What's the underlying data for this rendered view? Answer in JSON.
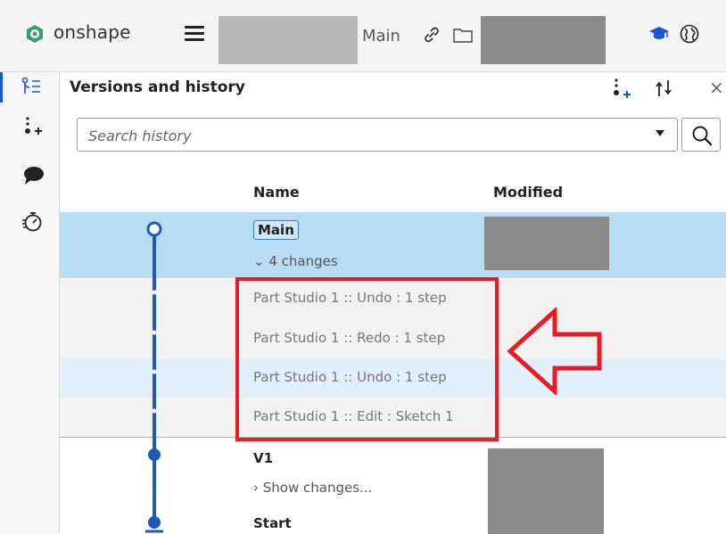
{
  "colors": {
    "accent": "#1a55d6",
    "timeline": "#1e5bb8",
    "selected_row": "#b8ddf3",
    "annotation_red": "#e81c24",
    "logo_green": "#3a9a6a"
  },
  "topbar": {
    "app_name": "onshape",
    "branch": "Main",
    "icons": [
      "onshape-logo-icon",
      "hamburger-menu-icon",
      "link-icon",
      "folder-icon",
      "learning-center-icon",
      "globe-icon"
    ]
  },
  "left_rail": {
    "icons": [
      "versions-history-icon",
      "add-version-icon",
      "comments-icon",
      "stopwatch-icon"
    ]
  },
  "panel": {
    "title": "Versions and history",
    "header_icons": [
      "add-version-icon",
      "compare-icon"
    ],
    "close_glyph": "×"
  },
  "search": {
    "placeholder": "Search history"
  },
  "columns": {
    "name": "Name",
    "modified": "Modified"
  },
  "history": {
    "main": {
      "label": "Main",
      "changes_toggle": "⌄ 4 changes"
    },
    "changes": [
      {
        "text": "Part Studio 1 :: Undo : 1 step"
      },
      {
        "text": "Part Studio 1 :: Redo : 1 step"
      },
      {
        "text": "Part Studio 1 :: Undo : 1 step"
      },
      {
        "text": "Part Studio 1 :: Edit : Sketch 1"
      }
    ],
    "v1": {
      "label": "V1",
      "show_changes": "› Show changes..."
    },
    "start": {
      "label": "Start"
    }
  }
}
